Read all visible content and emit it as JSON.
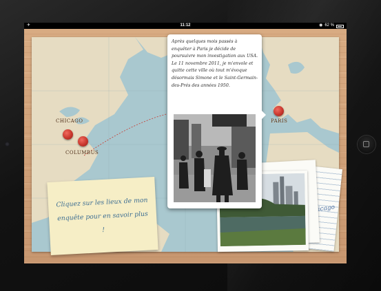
{
  "status_bar": {
    "left_icon": "airplane-icon",
    "time": "11:12",
    "battery": "62 %",
    "battery_level": 0.62
  },
  "map": {
    "cities": [
      {
        "id": "chicago",
        "label": "CHICAGO"
      },
      {
        "id": "columbus",
        "label": "COLUMBUS"
      },
      {
        "id": "paris",
        "label": "PARIS"
      }
    ]
  },
  "popup": {
    "text": "Après quelques mois passés à enquêter à Paris je décide de poursuivre mon investigation aux USA. Le 11 novembre 2011, je m'envole et quitte cette ville où tout m'évoque désormais Simone et le Saint-Germain-des-Prés des années 1950."
  },
  "note": {
    "text": "Cliquez sur les lieux de mon enquête pour en savoir plus !"
  },
  "photo_card": {
    "handwriting": "Chicago"
  },
  "colors": {
    "pin": "#c8372d",
    "ocean": "#a9c8cf",
    "land": "#e6dcc2",
    "note_ink": "#3c6d92",
    "wood": "#d2a47b"
  }
}
